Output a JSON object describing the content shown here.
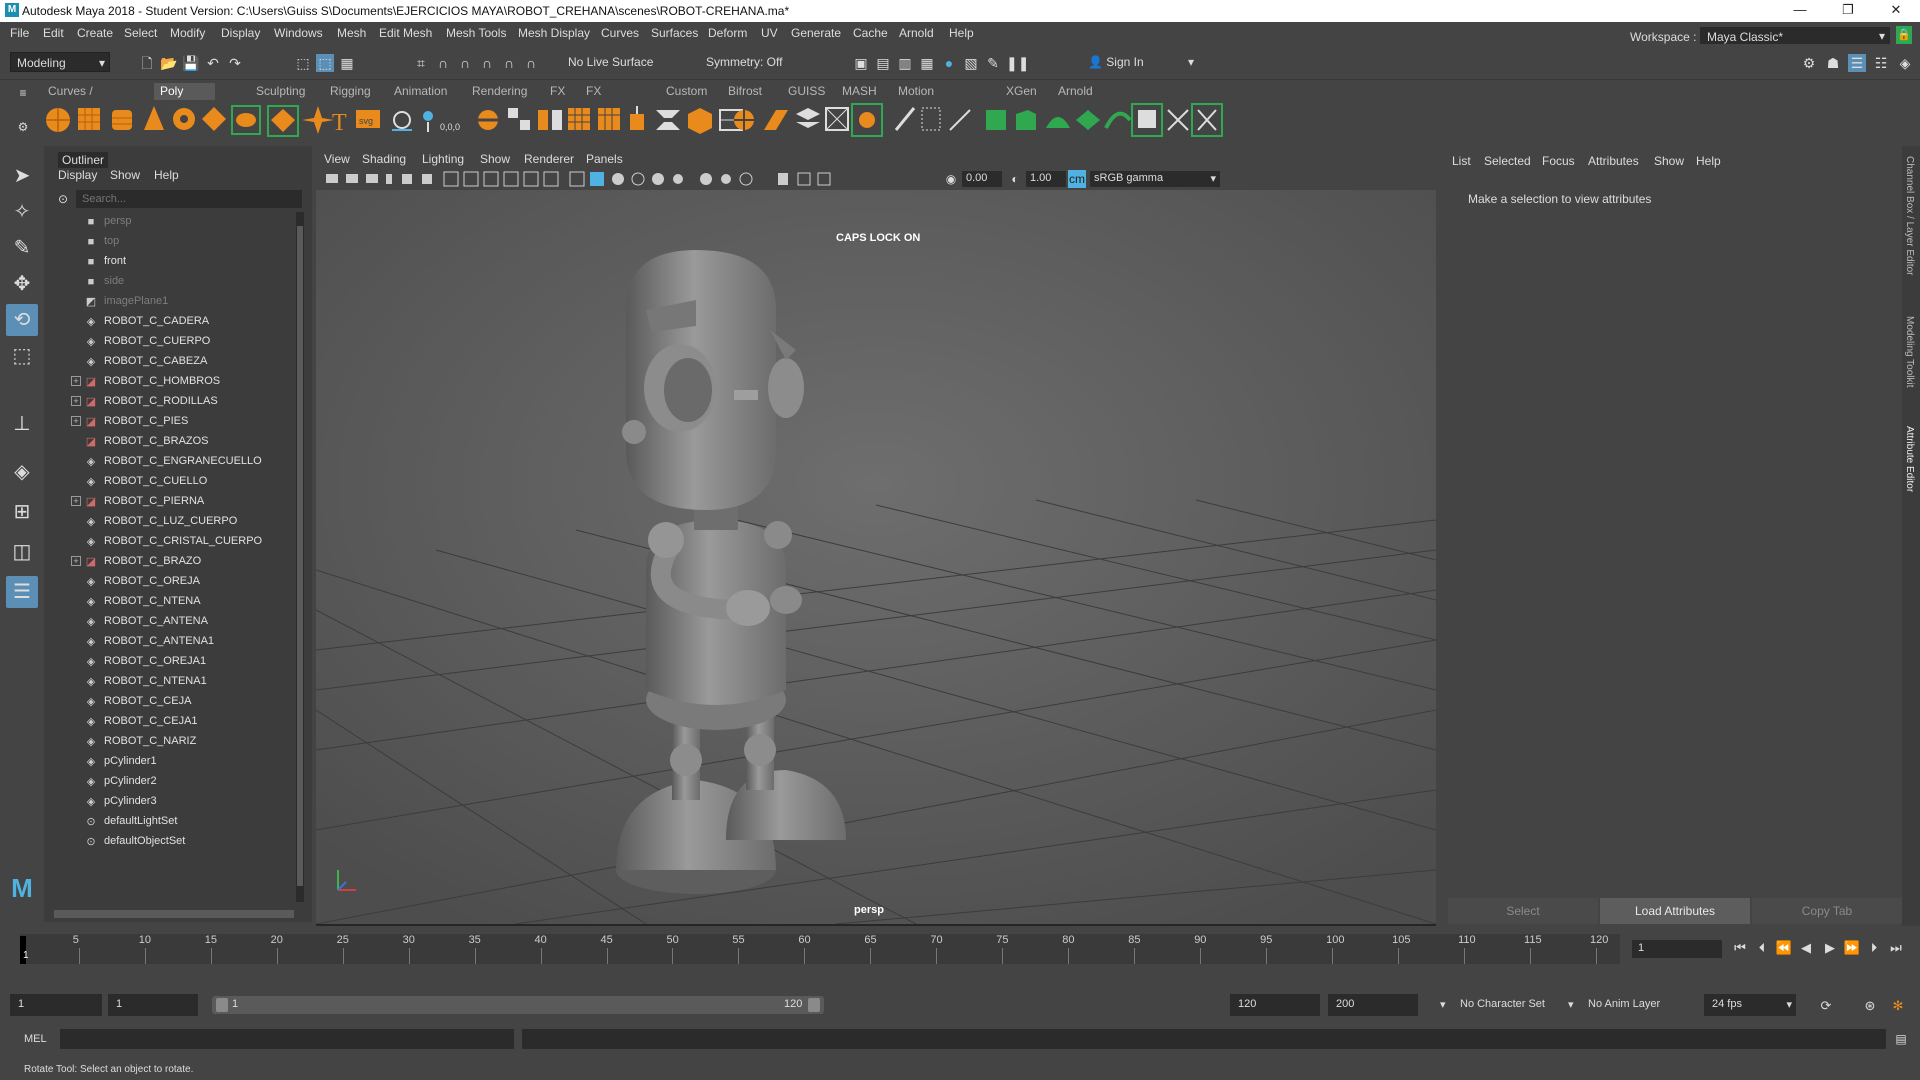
{
  "window": {
    "title": "Autodesk Maya 2018 - Student Version: C:\\Users\\Guiss S\\Documents\\EJERCICIOS MAYA\\ROBOT_CREHANA\\scenes\\ROBOT-CREHANA.ma*",
    "logo_letter": "M",
    "minimize": "—",
    "restore": "❐",
    "close": "✕"
  },
  "menubar": [
    "File",
    "Edit",
    "Create",
    "Select",
    "Modify",
    "Display",
    "Windows",
    "Mesh",
    "Edit Mesh",
    "Mesh Tools",
    "Mesh Display",
    "Curves",
    "Surfaces",
    "Deform",
    "UV",
    "Generate",
    "Cache",
    "Arnold",
    "Help"
  ],
  "workspace": {
    "label": "Workspace :",
    "value": "Maya Classic*"
  },
  "statusline": {
    "menu_set": "Modeling",
    "live_surface": "No Live Surface",
    "symmetry": "Symmetry: Off",
    "sign_in": "Sign In"
  },
  "shelf_tabs": [
    "Curves / Surfaces",
    "Poly Modeling",
    "Sculpting",
    "Rigging",
    "Animation",
    "Rendering",
    "FX",
    "FX Caching",
    "Custom",
    "Bifrost",
    "GUISS",
    "MASH",
    "Motion Graphics",
    "XGen",
    "Arnold"
  ],
  "shelf_active_tab": "Poly Modeling",
  "outliner": {
    "title": "Outliner",
    "menus": [
      "Display",
      "Show",
      "Help"
    ],
    "search_placeholder": "Search...",
    "items": [
      {
        "label": "persp",
        "icon": "camera-icon",
        "dim": true,
        "expand": false
      },
      {
        "label": "top",
        "icon": "camera-icon",
        "dim": true,
        "expand": false
      },
      {
        "label": "front",
        "icon": "camera-icon",
        "dim": false,
        "expand": false
      },
      {
        "label": "side",
        "icon": "camera-icon",
        "dim": true,
        "expand": false
      },
      {
        "label": "imagePlane1",
        "icon": "image-plane-icon",
        "dim": true,
        "expand": false
      },
      {
        "label": "ROBOT_C_CADERA",
        "icon": "mesh-icon",
        "dim": false,
        "expand": false
      },
      {
        "label": "ROBOT_C_CUERPO",
        "icon": "mesh-icon",
        "dim": false,
        "expand": false
      },
      {
        "label": "ROBOT_C_CABEZA",
        "icon": "mesh-icon",
        "dim": false,
        "expand": false
      },
      {
        "label": "ROBOT_C_HOMBROS",
        "icon": "group-icon",
        "dim": false,
        "expand": true
      },
      {
        "label": "ROBOT_C_RODILLAS",
        "icon": "group-icon",
        "dim": false,
        "expand": true
      },
      {
        "label": "ROBOT_C_PIES",
        "icon": "group-icon",
        "dim": false,
        "expand": true
      },
      {
        "label": "ROBOT_C_BRAZOS",
        "icon": "group-icon",
        "dim": false,
        "expand": false
      },
      {
        "label": "ROBOT_C_ENGRANECUELLO",
        "icon": "mesh-icon",
        "dim": false,
        "expand": false
      },
      {
        "label": "ROBOT_C_CUELLO",
        "icon": "mesh-icon",
        "dim": false,
        "expand": false
      },
      {
        "label": "ROBOT_C_PIERNA",
        "icon": "group-icon",
        "dim": false,
        "expand": true
      },
      {
        "label": "ROBOT_C_LUZ_CUERPO",
        "icon": "mesh-icon",
        "dim": false,
        "expand": false
      },
      {
        "label": "ROBOT_C_CRISTAL_CUERPO",
        "icon": "mesh-icon",
        "dim": false,
        "expand": false
      },
      {
        "label": "ROBOT_C_BRAZO",
        "icon": "group-icon",
        "dim": false,
        "expand": true
      },
      {
        "label": "ROBOT_C_OREJA",
        "icon": "mesh-icon",
        "dim": false,
        "expand": false
      },
      {
        "label": "ROBOT_C_NTENA",
        "icon": "mesh-icon",
        "dim": false,
        "expand": false
      },
      {
        "label": "ROBOT_C_ANTENA",
        "icon": "mesh-icon",
        "dim": false,
        "expand": false
      },
      {
        "label": "ROBOT_C_ANTENA1",
        "icon": "mesh-icon",
        "dim": false,
        "expand": false
      },
      {
        "label": "ROBOT_C_OREJA1",
        "icon": "mesh-icon",
        "dim": false,
        "expand": false
      },
      {
        "label": "ROBOT_C_NTENA1",
        "icon": "mesh-icon",
        "dim": false,
        "expand": false
      },
      {
        "label": "ROBOT_C_CEJA",
        "icon": "mesh-icon",
        "dim": false,
        "expand": false
      },
      {
        "label": "ROBOT_C_CEJA1",
        "icon": "mesh-icon",
        "dim": false,
        "expand": false
      },
      {
        "label": "ROBOT_C_NARIZ",
        "icon": "mesh-icon",
        "dim": false,
        "expand": false
      },
      {
        "label": "pCylinder1",
        "icon": "mesh-icon",
        "dim": false,
        "expand": false
      },
      {
        "label": "pCylinder2",
        "icon": "mesh-icon",
        "dim": false,
        "expand": false
      },
      {
        "label": "pCylinder3",
        "icon": "mesh-icon",
        "dim": false,
        "expand": false
      },
      {
        "label": "defaultLightSet",
        "icon": "set-icon",
        "dim": false,
        "expand": false
      },
      {
        "label": "defaultObjectSet",
        "icon": "set-icon",
        "dim": false,
        "expand": false
      }
    ]
  },
  "viewport": {
    "menus": [
      "View",
      "Shading",
      "Lighting",
      "Show",
      "Renderer",
      "Panels"
    ],
    "near_value": "0.00",
    "far_value": "1.00",
    "color_space": "sRGB gamma",
    "caps_lock": "CAPS LOCK ON",
    "camera_label": "persp"
  },
  "attribute_editor": {
    "menus": [
      "List",
      "Selected",
      "Focus",
      "Attributes",
      "Show",
      "Help"
    ],
    "message": "Make a selection to view attributes",
    "buttons": [
      "Select",
      "Load Attributes",
      "Copy Tab"
    ]
  },
  "side_tabs": [
    "Channel Box / Layer Editor",
    "Modeling Toolkit",
    "Attribute Editor"
  ],
  "time_slider": {
    "ticks": [
      "5",
      "10",
      "15",
      "20",
      "25",
      "30",
      "35",
      "40",
      "45",
      "50",
      "55",
      "60",
      "65",
      "70",
      "75",
      "80",
      "85",
      "90",
      "95",
      "100",
      "105",
      "110",
      "115",
      "120"
    ],
    "current_frame_label": "1",
    "current_frame": "1"
  },
  "range": {
    "start": "1",
    "playback_start": "1",
    "slider_start": "1",
    "slider_end": "120",
    "playback_end": "120",
    "end": "200",
    "character_set": "No Character Set",
    "anim_layer": "No Anim Layer",
    "fps": "24 fps"
  },
  "command_line": {
    "language": "MEL"
  },
  "help_line": "Rotate Tool: Select an object to rotate.",
  "colors": {
    "accent": "#5c8fb6",
    "panel": "#444444",
    "dark": "#2b2b2b",
    "shelf_green": "#2fa84f",
    "shelf_orange": "#e88a1c"
  }
}
